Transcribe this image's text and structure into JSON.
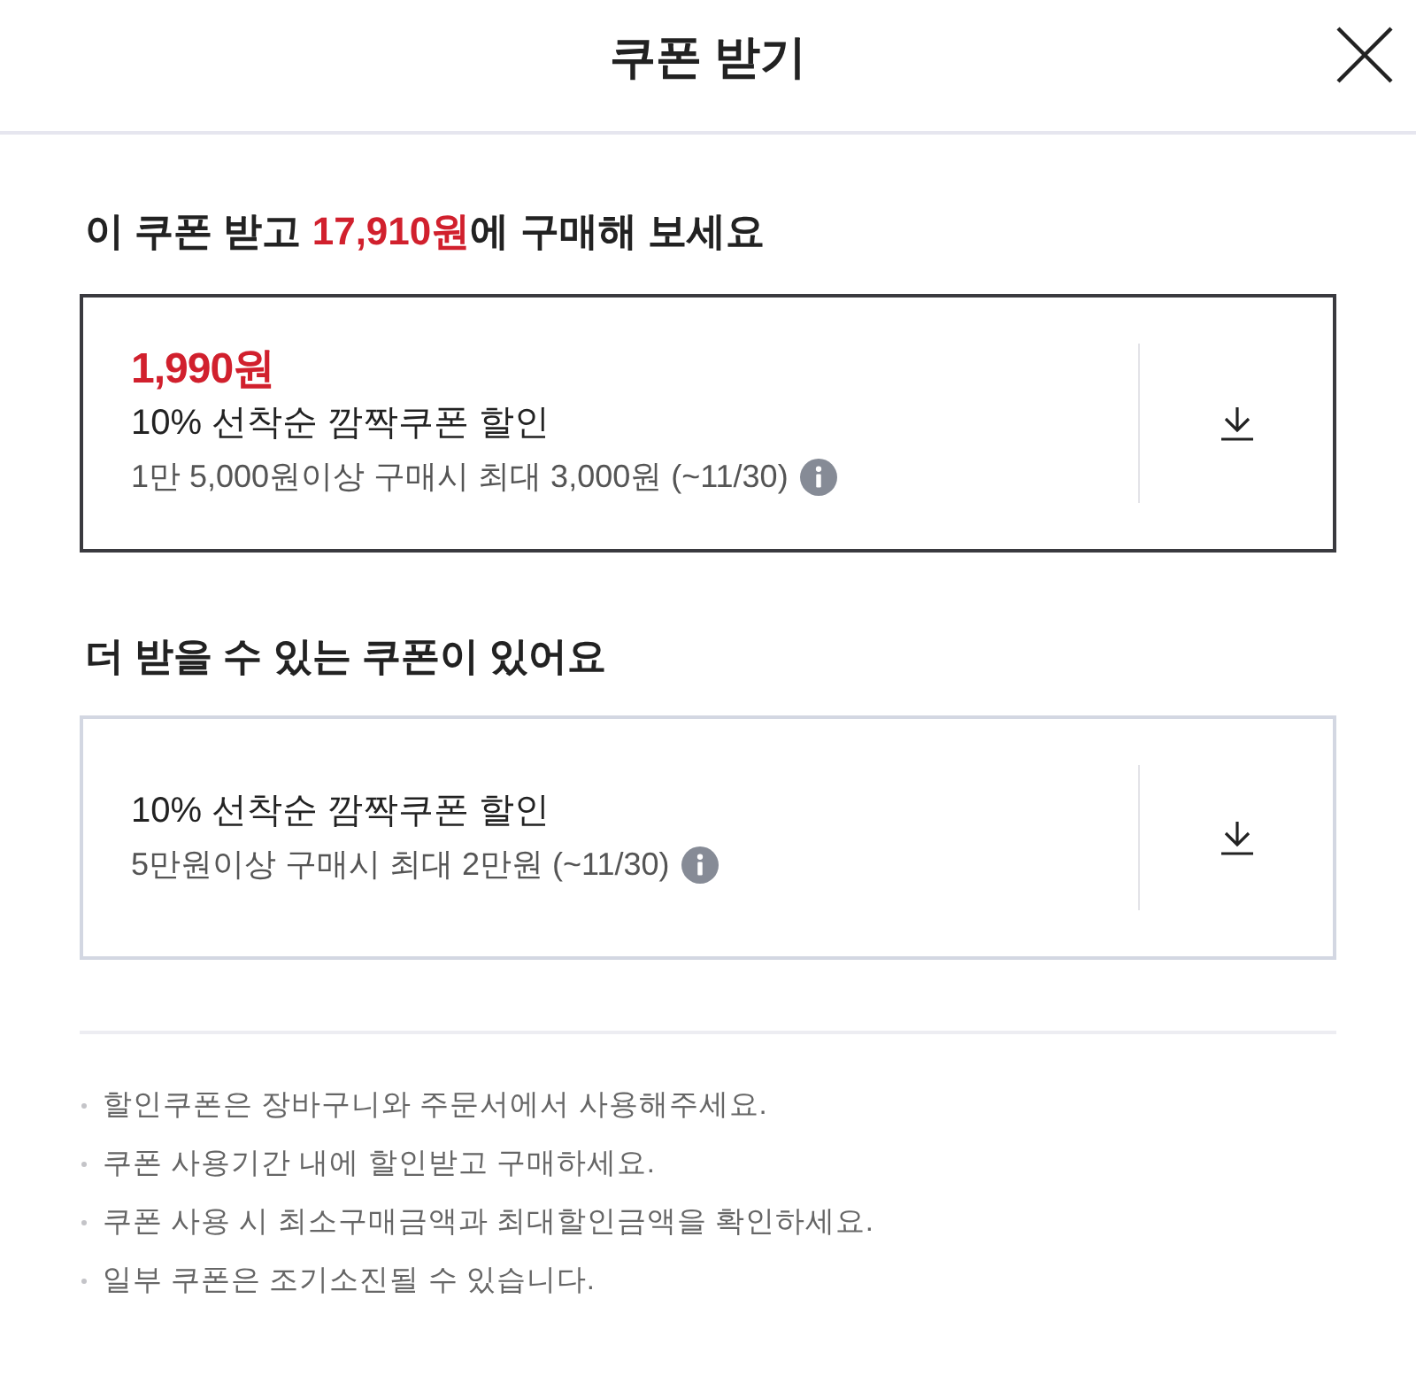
{
  "header": {
    "title": "쿠폰 받기"
  },
  "applied_section": {
    "heading": {
      "before": "이 쿠폰 받고 ",
      "highlight": "17,910원",
      "after": "에 구매해 보세요"
    },
    "coupons": [
      {
        "price": "1,990원",
        "title": "10% 선착순 깜짝쿠폰 할인",
        "condition": "1만 5,000원이상 구매시 최대 3,000원 (~11/30)",
        "selected": true
      }
    ]
  },
  "more_section": {
    "heading": "더 받을 수 있는 쿠폰이 있어요",
    "coupons": [
      {
        "title": "10% 선착순 깜짝쿠폰 할인",
        "condition": "5만원이상 구매시 최대 2만원 (~11/30)",
        "selected": false
      }
    ]
  },
  "notes": [
    "할인쿠폰은 장바구니와 주문서에서 사용해주세요.",
    "쿠폰 사용기간 내에 할인받고 구매하세요.",
    "쿠폰 사용 시 최소구매금액과 최대할인금액을 확인하세요.",
    "일부 쿠폰은 조기소진될 수 있습니다."
  ]
}
